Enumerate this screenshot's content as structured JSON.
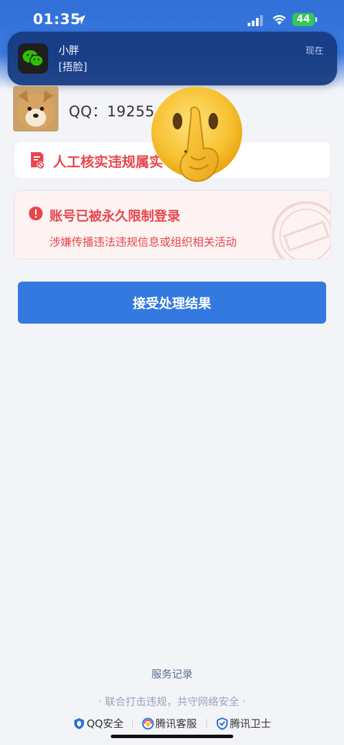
{
  "status_bar": {
    "time": "01:35",
    "battery": "44",
    "battery_color": "#34c759"
  },
  "notification": {
    "app_icon": "wechat-icon",
    "title": "小胖",
    "message": "[捂脸]",
    "time": "现在"
  },
  "account": {
    "qq_label": "QQ：19255"
  },
  "violation_card": {
    "icon": "document-ban-icon",
    "text": "人工核实违规属实"
  },
  "restriction_card": {
    "icon": "alert-circle-icon",
    "title": "账号已被永久限制登录",
    "description": "涉嫌传播违法违规信息或组织相关活动",
    "stamp_icon": "warning-stamp-icon"
  },
  "accept_button": {
    "label": "接受处理结果",
    "color": "#3379e0"
  },
  "overlay": {
    "emoji": "shushing-face-emoji"
  },
  "footer": {
    "service_record": "服务记录",
    "slogan": "· 联合打击违规，共守网络安全 ·",
    "links": [
      {
        "label": "QQ安全",
        "icon": "qq-shield-icon"
      },
      {
        "label": "腾讯客服",
        "icon": "customer-service-icon"
      },
      {
        "label": "腾讯卫士",
        "icon": "shield-guard-icon"
      }
    ]
  },
  "accent_red": "#e8464c"
}
